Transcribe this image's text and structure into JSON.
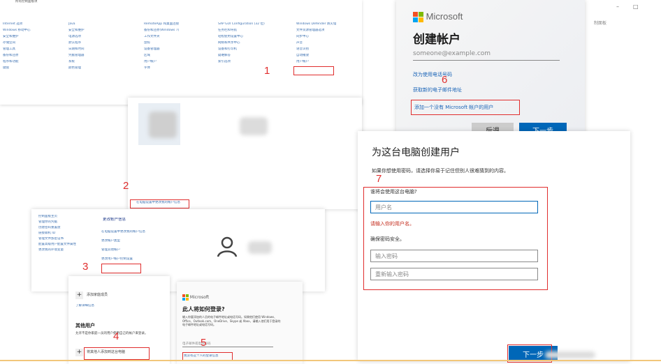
{
  "control_panel": {
    "title_partial": "所有控制面板项",
    "columns": [
      [
        "Internet 选项",
        "Windows 移动中心",
        "安全和维护",
        "存储空间",
        "管理工具",
        "备份和还原",
        "程序和功能",
        "键盘"
      ],
      [
        "Java",
        "安全和维护",
        "电源选项",
        "默认程序",
        "日期和时间",
        "凭据管理器",
        "系统",
        "颜色管理"
      ],
      [
        "RemoteApp 和桌面连接",
        "备份和还原(Windows 7)",
        "工作文件夹",
        "鼠标",
        "设备管理器",
        "区域",
        "用户帐户",
        "字体"
      ],
      [
        "SAP GUI Configuration (32 位)",
        "任务栏和导航",
        "轻松使用设置中心",
        "网络和共享中心",
        "设备和打印机",
        "疑难解答",
        "索引选项"
      ],
      [
        "Windows Defender 防火墙",
        "文件资源管理器选项",
        "同步中心",
        "声音",
        "语音识别",
        "自动播放",
        "用户帐户"
      ]
    ],
    "marker": "1"
  },
  "user_accounts_panel": {
    "link": "在电脑设置中更改我的帐户信息",
    "marker": "2"
  },
  "manage_accounts_panel": {
    "sidebar": [
      "控制面板主页",
      "管理你的凭据",
      "创建密码重置盘",
      "链接联机 ID",
      "管理文件加密证书",
      "配置高级用户配置文件属性",
      "更改我的环境变量"
    ],
    "heading": "更改帐户信息",
    "links": [
      "在电脑设置中更改我的帐户信息",
      "更改帐户类型",
      "管理其他帐户",
      "更改用户帐户控制设置"
    ],
    "marker": "3"
  },
  "family_panel": {
    "add_family": "添加家庭成员",
    "learn_more": "了解详细信息",
    "heading": "其他用户",
    "desc": "允许不是你家庭一员的用户使用自己的帐户来登录。",
    "add_other": "将其他人添加到这台电脑",
    "marker": "4"
  },
  "how_sign_in_panel": {
    "brand": "Microsoft",
    "heading": "此人将如何登录?",
    "body": "输入你要添加的人员的电子邮件地址或电话号码。如果他们使用 Windows、Office、Outlook.com、OneDrive、Skype 或 Xbox，请输入他们用于登录的电子邮件地址或电话号码。",
    "field_placeholder": "电子邮件或电话号码",
    "link": "我没有这个人的登录信息",
    "marker": "5"
  },
  "create_account_panel": {
    "brand": "Microsoft",
    "heading": "创建帐户",
    "email_placeholder": "someone@example.com",
    "link_phone": "改为使用电话号码",
    "link_new_email": "获取新的电子邮件地址",
    "link_no_ms": "添加一个没有 Microsoft 帐户的用户",
    "back_button": "后退",
    "next_button": "下一步",
    "marker": "6"
  },
  "local_user_panel": {
    "heading": "为这台电脑创建用户",
    "desc": "如果你想使用密码，请选择你易于记住但别人很难猜到的内容。",
    "question": "谁将会使用这台电脑?",
    "username_placeholder": "用户名",
    "error": "请输入你的用户名。",
    "password_prompt": "确保密码安全。",
    "password_placeholder": "输入密码",
    "password_confirm_placeholder": "重新输入密码",
    "next_button": "下一步",
    "marker": "7"
  },
  "window_controls": {
    "minimize": "–",
    "maximize": "□",
    "side_text": "制面板"
  },
  "colors": {
    "accent": "#0067b8",
    "marker_red": "#e02d2d",
    "link_blue": "#1a64b7",
    "ms_red": "#f25022",
    "ms_green": "#7fba00",
    "ms_blue": "#00a4ef",
    "ms_yellow": "#ffb900"
  }
}
